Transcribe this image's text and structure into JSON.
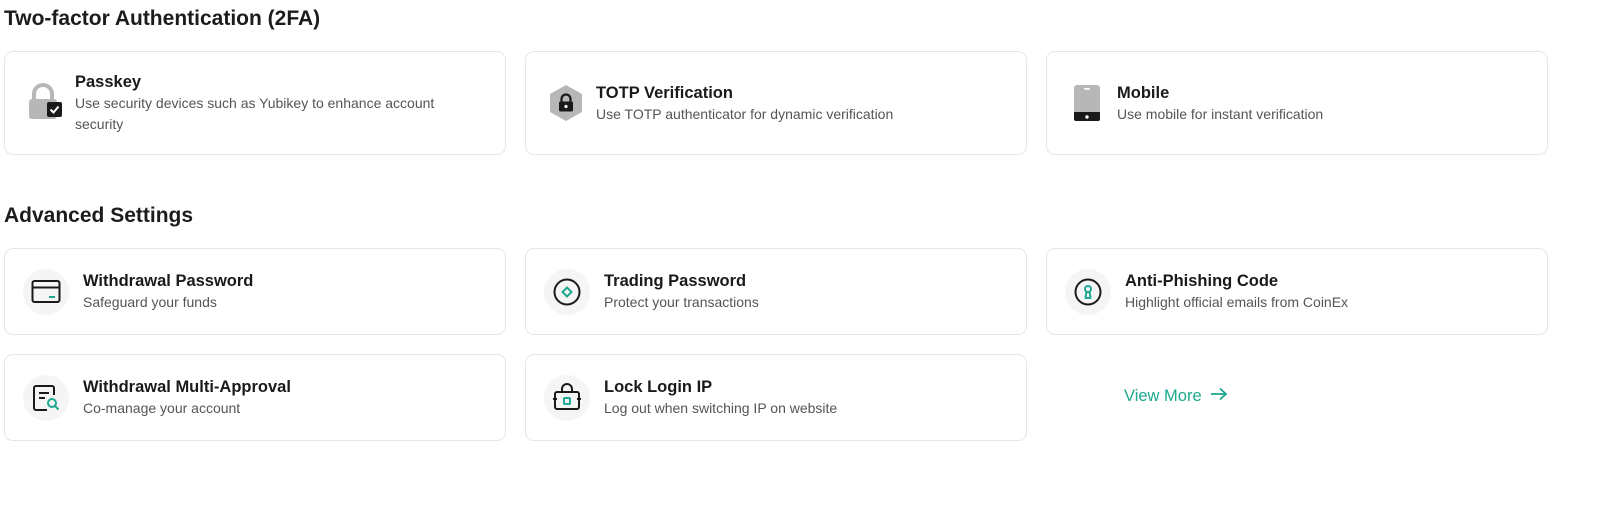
{
  "sections": {
    "two_fa": {
      "title": "Two-factor Authentication (2FA)",
      "cards": [
        {
          "title": "Passkey",
          "desc": "Use security devices such as Yubikey to enhance account security",
          "icon": "padlock-check-icon"
        },
        {
          "title": "TOTP Verification",
          "desc": "Use TOTP authenticator for dynamic verification",
          "icon": "hexagon-lock-icon"
        },
        {
          "title": "Mobile",
          "desc": "Use mobile for instant verification",
          "icon": "mobile-phone-icon"
        }
      ]
    },
    "advanced": {
      "title": "Advanced Settings",
      "cards": [
        {
          "title": "Withdrawal Password",
          "desc": "Safeguard your funds",
          "icon": "card-icon"
        },
        {
          "title": "Trading Password",
          "desc": "Protect your transactions",
          "icon": "circle-diamond-icon"
        },
        {
          "title": "Anti-Phishing Code",
          "desc": "Highlight official emails from CoinEx",
          "icon": "keyhole-icon"
        },
        {
          "title": "Withdrawal Multi-Approval",
          "desc": "Co-manage your account",
          "icon": "document-search-icon"
        },
        {
          "title": "Lock Login IP",
          "desc": "Log out when switching IP on website",
          "icon": "briefcase-lock-icon"
        }
      ],
      "view_more": "View More"
    }
  },
  "colors": {
    "accent": "#1ea88f",
    "border": "#e6e6e6",
    "icon_gray": "#b7b7b7",
    "icon_dark": "#1a1a1a"
  }
}
